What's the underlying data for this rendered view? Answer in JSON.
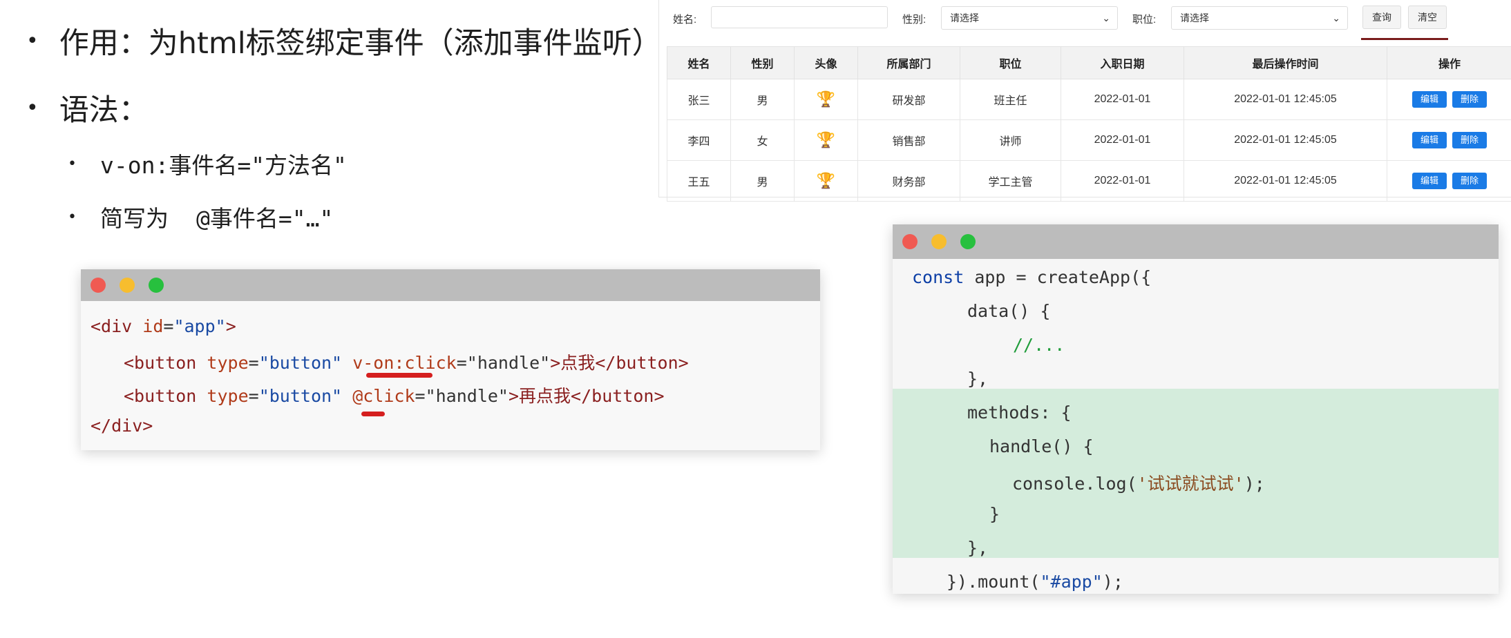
{
  "slide": {
    "bullet1": "作用：为html标签绑定事件（添加事件监听）",
    "bullet2": "语法：",
    "sub1": "v-on:事件名=\"方法名\"",
    "sub2_prefix": "简写为",
    "sub2_code": "@事件名=\"…\""
  },
  "code_left": {
    "l1_a": "<div ",
    "l1_b": "id",
    "l1_c": "=",
    "l1_d": "\"app\"",
    "l1_e": ">",
    "l2_a": "<button ",
    "l2_b": "type",
    "l2_c": "=",
    "l2_d": "\"button\"",
    "l2_e": " ",
    "l2_f": "v-on:click",
    "l2_g": "=",
    "l2_h": "\"handle\"",
    "l2_i": ">点我</button>",
    "l3_a": "<button ",
    "l3_b": "type",
    "l3_c": "=",
    "l3_d": "\"button\"",
    "l3_e": " ",
    "l3_f": "@click",
    "l3_g": "=",
    "l3_h": "\"handle\"",
    "l3_i": ">再点我</button>",
    "l4": "</div>"
  },
  "code_right": {
    "l1_kw": "const",
    "l1_rest": " app = createApp({",
    "l2": "data() {",
    "l3": "//...",
    "l4": "},",
    "l5": "methods: {",
    "l6": "handle() {",
    "l7_a": "console.log(",
    "l7_b": "'试试就试试'",
    "l7_c": ");",
    "l8": "}",
    "l9": "},",
    "l10_a": "}).mount(",
    "l10_b": "\"#app\"",
    "l10_c": ");"
  },
  "app": {
    "filters": {
      "name_label": "姓名:",
      "gender_label": "性别:",
      "gender_value": "请选择",
      "position_label": "职位:",
      "position_value": "请选择",
      "search_button": "查询",
      "clear_button": "清空"
    },
    "table": {
      "headers": [
        "姓名",
        "性别",
        "头像",
        "所属部门",
        "职位",
        "入职日期",
        "最后操作时间",
        "操作"
      ],
      "rows": [
        {
          "name": "张三",
          "gender": "男",
          "dept": "研发部",
          "position": "班主任",
          "date": "2022-01-01",
          "last_op": "2022-01-01 12:45:05"
        },
        {
          "name": "李四",
          "gender": "女",
          "dept": "销售部",
          "position": "讲师",
          "date": "2022-01-01",
          "last_op": "2022-01-01 12:45:05"
        },
        {
          "name": "王五",
          "gender": "男",
          "dept": "财务部",
          "position": "学工主管",
          "date": "2022-01-01",
          "last_op": "2022-01-01 12:45:05"
        }
      ],
      "edit_label": "编辑",
      "delete_label": "删除",
      "avatar_icon": "trophy-icon"
    },
    "accent_color": "#1a7be6"
  }
}
